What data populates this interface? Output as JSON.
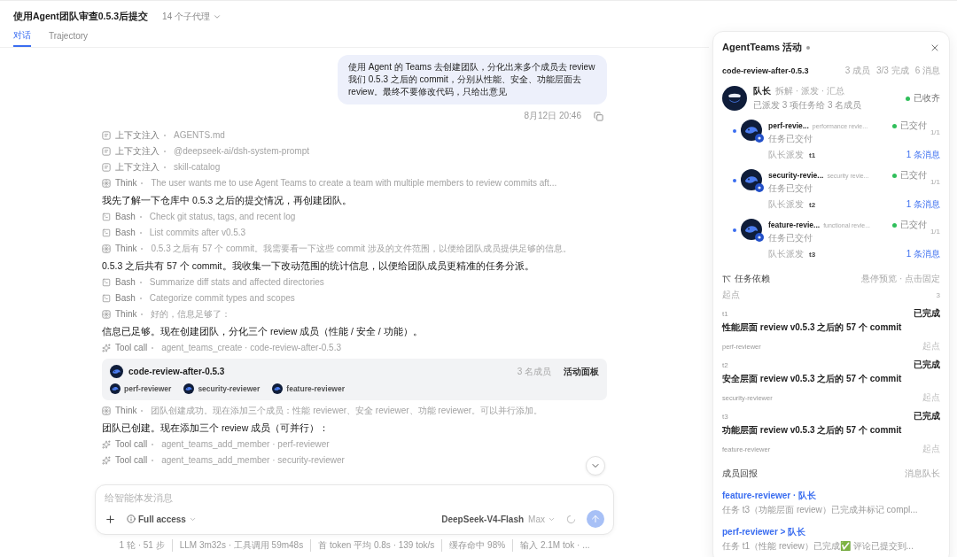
{
  "header": {
    "title": "使用Agent团队审查0.5.3后提交",
    "subagents": "14 个子代理"
  },
  "tabs": [
    {
      "label": "对话",
      "selected": true
    },
    {
      "label": "Trajectory",
      "selected": false
    }
  ],
  "conversation": {
    "user_message": {
      "text": "使用 Agent 的 Teams 去创建团队，分化出来多个成员去 review 我们 0.5.3 之后的 commit，分别从性能、安全、功能层面去 review。最终不要修改代码，只给出意见",
      "time": "8月12日 20:46"
    },
    "steps": [
      {
        "kind": "context",
        "label": "上下文注入",
        "detail": "AGENTS.md"
      },
      {
        "kind": "context",
        "label": "上下文注入",
        "detail": "@deepseek-ai/dsh-system-prompt"
      },
      {
        "kind": "context",
        "label": "上下文注入",
        "detail": "skill-catalog"
      },
      {
        "kind": "think",
        "label": "Think",
        "detail": "The user wants me to use Agent Teams to create a team with multiple members to review commits aft..."
      },
      {
        "kind": "text",
        "text": "我先了解一下仓库中 0.5.3 之后的提交情况，再创建团队。"
      },
      {
        "kind": "bash",
        "label": "Bash",
        "detail": "Check git status, tags, and recent log"
      },
      {
        "kind": "bash",
        "label": "Bash",
        "detail": "List commits after v0.5.3"
      },
      {
        "kind": "think",
        "label": "Think",
        "detail": "0.5.3 之后有 57 个 commit。我需要看一下这些 commit 涉及的文件范围，以便给团队成员提供足够的信息。"
      },
      {
        "kind": "text",
        "text": "0.5.3 之后共有 57 个 commit。我收集一下改动范围的统计信息，以便给团队成员更精准的任务分派。"
      },
      {
        "kind": "bash",
        "label": "Bash",
        "detail": "Summarize diff stats and affected directories"
      },
      {
        "kind": "bash",
        "label": "Bash",
        "detail": "Categorize commit types and scopes"
      },
      {
        "kind": "think",
        "label": "Think",
        "detail": "好的，信息足够了："
      },
      {
        "kind": "text",
        "text": "信息已足够。现在创建团队，分化三个 review 成员（性能 / 安全 / 功能）。"
      },
      {
        "kind": "tool_call",
        "label": "Tool call",
        "detail": "agent_teams_create · code-review-after-0.5.3"
      },
      {
        "kind": "team_card",
        "name": "code-review-after-0.5.3",
        "count": "3 名成员",
        "action": "活动面板",
        "members": [
          "perf-reviewer",
          "security-reviewer",
          "feature-reviewer"
        ]
      },
      {
        "kind": "think",
        "label": "Think",
        "detail": "团队创建成功。现在添加三个成员：性能 reviewer、安全 reviewer、功能 reviewer。可以并行添加。"
      },
      {
        "kind": "text",
        "text": "团队已创建。现在添加三个 review 成员（可并行）："
      },
      {
        "kind": "tool_call",
        "label": "Tool call",
        "detail": "agent_teams_add_member · perf-reviewer"
      },
      {
        "kind": "tool_call",
        "label": "Tool call",
        "detail": "agent_teams_add_member · security-reviewer"
      }
    ]
  },
  "composer": {
    "placeholder": "给智能体发消息",
    "access": "Full access",
    "model": "DeepSeek-V4-Flash",
    "effort": "Max"
  },
  "stats": [
    "1 轮 · 51 步",
    "LLM 3m32s · 工具调用 59m48s",
    "首 token 平均 0.8s · 139 tok/s",
    "缓存命中 98%",
    "输入 2.1M tok · ..."
  ],
  "activity_panel": {
    "title": "AgentTeams 活动",
    "team": {
      "name": "code-review-after-0.5.3",
      "stats": [
        "3 成员",
        "3/3 完成",
        "6 消息"
      ]
    },
    "leader": {
      "name": "队长",
      "role": "拆解 · 派发 · 汇总",
      "summary": "已派发 3 项任务给 3 名成员",
      "status": "已收齐"
    },
    "members": [
      {
        "name": "perf-revie...",
        "role": "performance revie...",
        "status": "已交付",
        "progress": "1/1",
        "note": "任务已交付",
        "assigned_by": "队长派发",
        "task": "t1",
        "messages": "1 条消息",
        "unread": true
      },
      {
        "name": "security-revie...",
        "role": "security revie...",
        "status": "已交付",
        "progress": "1/1",
        "note": "任务已交付",
        "assigned_by": "队长派发",
        "task": "t2",
        "messages": "1 条消息",
        "unread": true
      },
      {
        "name": "feature-revie...",
        "role": "functional revie...",
        "status": "已交付",
        "progress": "1/1",
        "note": "任务已交付",
        "assigned_by": "队长派发",
        "task": "t3",
        "messages": "1 条消息",
        "unread": true
      }
    ],
    "dependencies": {
      "title": "任务依赖",
      "hint": "悬停预览 · 点击固定",
      "roots_label": "起点",
      "roots_count": "3",
      "tasks": [
        {
          "id": "t1",
          "status": "已完成",
          "title": "性能层面 review v0.5.3 之后的 57 个 commit",
          "owner": "perf-reviewer",
          "tag": "起点"
        },
        {
          "id": "t2",
          "status": "已完成",
          "title": "安全层面 review v0.5.3 之后的 57 个 commit",
          "owner": "security-reviewer",
          "tag": "起点"
        },
        {
          "id": "t3",
          "status": "已完成",
          "title": "功能层面 review v0.5.3 之后的 57 个 commit",
          "owner": "feature-reviewer",
          "tag": "起点"
        }
      ]
    },
    "reports": {
      "title": "成员回报",
      "action": "消息队长",
      "items": [
        {
          "from": "feature-reviewer",
          "separator": "·",
          "to": "队长",
          "text": "任务 t3（功能层面 review）已完成并标记 compl..."
        },
        {
          "from": "perf-reviewer",
          "separator": ">",
          "to": "队长",
          "text": "任务 t1（性能 review）已完成✅ 评论已提交到..."
        }
      ]
    }
  }
}
